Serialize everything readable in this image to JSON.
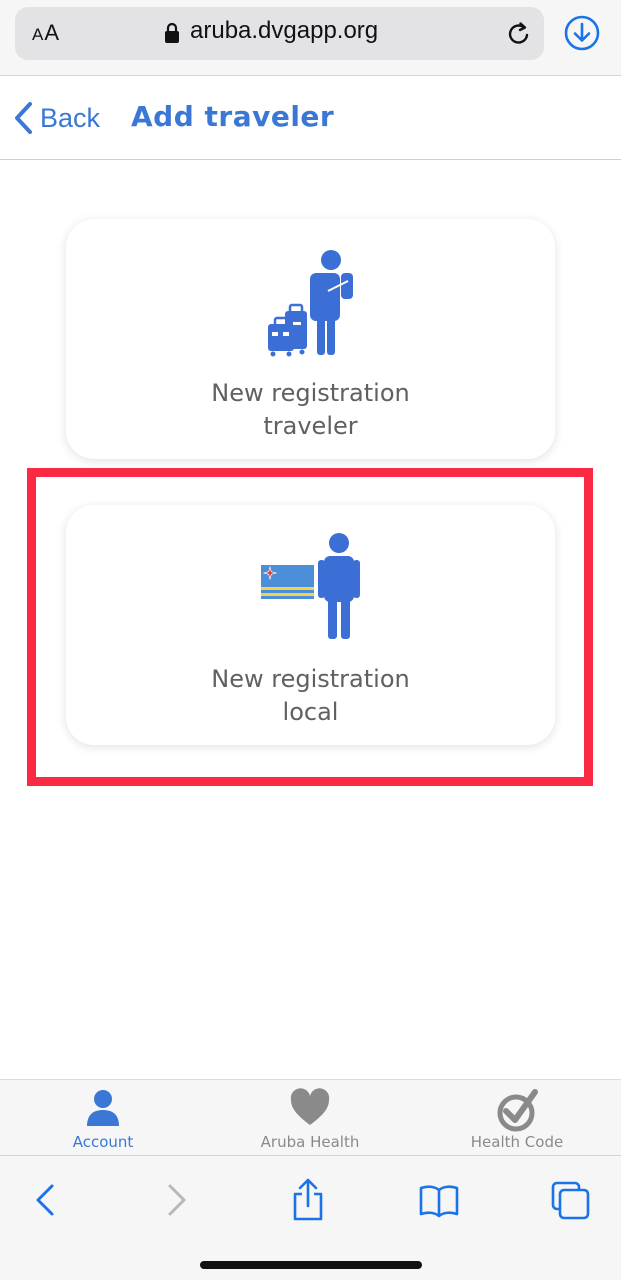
{
  "browser": {
    "text_size_label": "AA",
    "url": "aruba.dvgapp.org"
  },
  "header": {
    "back_label": "Back",
    "title": "Add traveler"
  },
  "cards": [
    {
      "line1": "New registration",
      "line2": "traveler"
    },
    {
      "line1": "New registration",
      "line2": "local"
    }
  ],
  "tabs": [
    {
      "label": "Account",
      "active": true
    },
    {
      "label": "Aruba Health",
      "active": false
    },
    {
      "label": "Health Code",
      "active": false
    }
  ],
  "colors": {
    "accent": "#3b77d4",
    "highlight": "#fa2a45",
    "flag_blue": "#4a8fd8",
    "flag_yellow": "#f2d24b",
    "safari_blue": "#1a73e8"
  }
}
